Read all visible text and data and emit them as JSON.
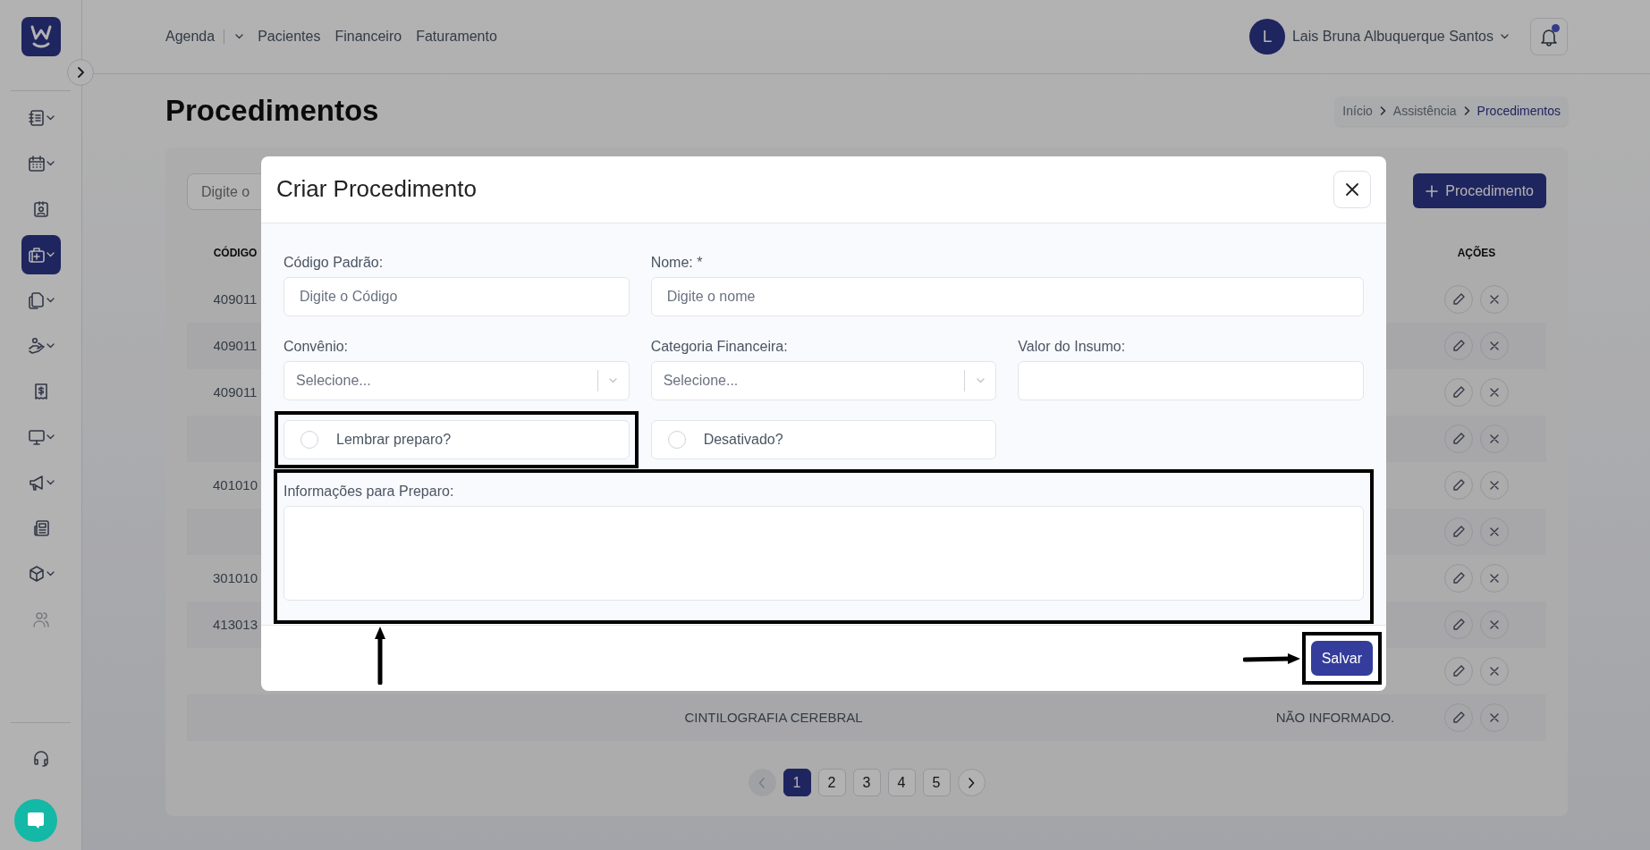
{
  "sidebar": {
    "items": [
      {
        "submenu": true,
        "selected": false,
        "disabled": false
      },
      {
        "submenu": true,
        "selected": false,
        "disabled": false
      },
      {
        "submenu": false,
        "selected": false,
        "disabled": false
      },
      {
        "submenu": true,
        "selected": true,
        "disabled": false
      },
      {
        "submenu": true,
        "selected": false,
        "disabled": false
      },
      {
        "submenu": true,
        "selected": false,
        "disabled": false
      },
      {
        "submenu": false,
        "selected": false,
        "disabled": false
      },
      {
        "submenu": true,
        "selected": false,
        "disabled": false
      },
      {
        "submenu": true,
        "selected": false,
        "disabled": false
      },
      {
        "submenu": false,
        "selected": false,
        "disabled": false
      },
      {
        "submenu": true,
        "selected": false,
        "disabled": false
      },
      {
        "submenu": false,
        "selected": false,
        "disabled": true
      }
    ]
  },
  "nav": [
    {
      "label": "Agenda",
      "dropdown": true
    },
    {
      "label": "Pacientes"
    },
    {
      "label": "Financeiro"
    },
    {
      "label": "Faturamento"
    }
  ],
  "user": {
    "initial": "L",
    "name": "Lais Bruna Albuquerque Santos"
  },
  "notifications": {
    "unread": true
  },
  "page_title": "Procedimentos",
  "breadcrumb": [
    {
      "label": "Início",
      "selected": false
    },
    {
      "label": "Assistência",
      "selected": false
    },
    {
      "label": "Procedimentos",
      "selected": true
    }
  ],
  "search": {
    "placeholder": "Digite o"
  },
  "add_button": {
    "label": "Procedimento"
  },
  "table": {
    "columns": [
      "CÓDIGO",
      "AÇÕES"
    ],
    "rows": [
      {
        "code": "409011"
      },
      {
        "code": "409011"
      },
      {
        "code": "409011"
      },
      {},
      {
        "code": "401010"
      },
      {},
      {
        "code": "301010"
      },
      {
        "code": "413013"
      },
      {},
      {
        "column_2": "CINTILOGRAFIA CEREBRAL",
        "column_3": "NÃO INFORMADO."
      }
    ]
  },
  "pagination": {
    "prev_disabled": true,
    "pages": [
      {
        "label": "1",
        "selected": true
      },
      {
        "label": "2",
        "selected": false
      },
      {
        "label": "3",
        "selected": false
      },
      {
        "label": "4",
        "selected": false
      },
      {
        "label": "5",
        "selected": false
      }
    ]
  },
  "modal": {
    "title": "Criar Procedimento",
    "fields": [
      {
        "kind": "text",
        "label": "Código Padrão:",
        "placeholder": "Digite o Código"
      },
      {
        "kind": "text",
        "label": "Nome: *",
        "placeholder": "Digite o nome"
      },
      {
        "kind": "select",
        "label": "Convênio:",
        "placeholder": "Selecione..."
      },
      {
        "kind": "select",
        "label": "Categoria Financeira:",
        "placeholder": "Selecione..."
      },
      {
        "kind": "text",
        "label": "Valor do Insumo:"
      },
      {
        "kind": "checkbox",
        "label": "Lembrar preparo?",
        "checked": false
      },
      {
        "kind": "checkbox",
        "label": "Desativado?",
        "checked": false
      },
      {
        "kind": "textarea",
        "label": "Informações para Preparo:"
      }
    ],
    "save_button": "Salvar"
  }
}
